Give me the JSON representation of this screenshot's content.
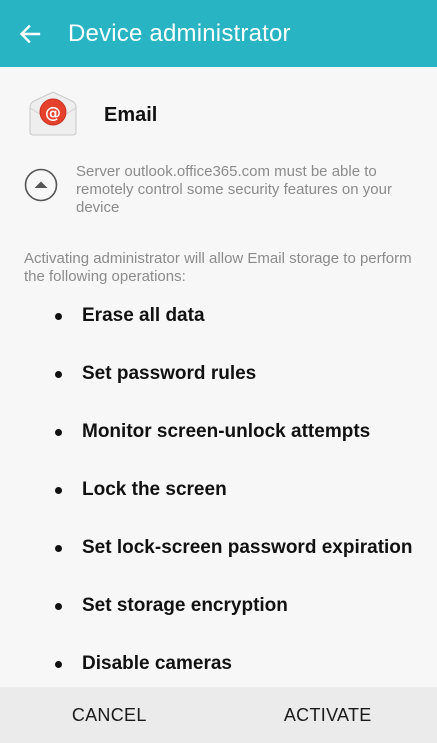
{
  "appbar": {
    "title": "Device administrator",
    "back_icon": "arrow-left-icon",
    "background": "#28b4c3"
  },
  "app": {
    "name": "Email",
    "icon": "email-at-icon",
    "icon_color": "#e5412d"
  },
  "server_notice": "Server outlook.office365.com must be able to remotely control some security features on your device",
  "collapse_icon": "chevron-up-circle-icon",
  "intro": "Activating administrator will allow Email storage to perform the following operations:",
  "operations": [
    "Erase all data",
    "Set password rules",
    "Monitor screen-unlock attempts",
    "Lock the screen",
    "Set lock-screen password expiration",
    "Set storage encryption",
    "Disable cameras"
  ],
  "actions": {
    "cancel_label": "CANCEL",
    "activate_label": "ACTIVATE"
  }
}
